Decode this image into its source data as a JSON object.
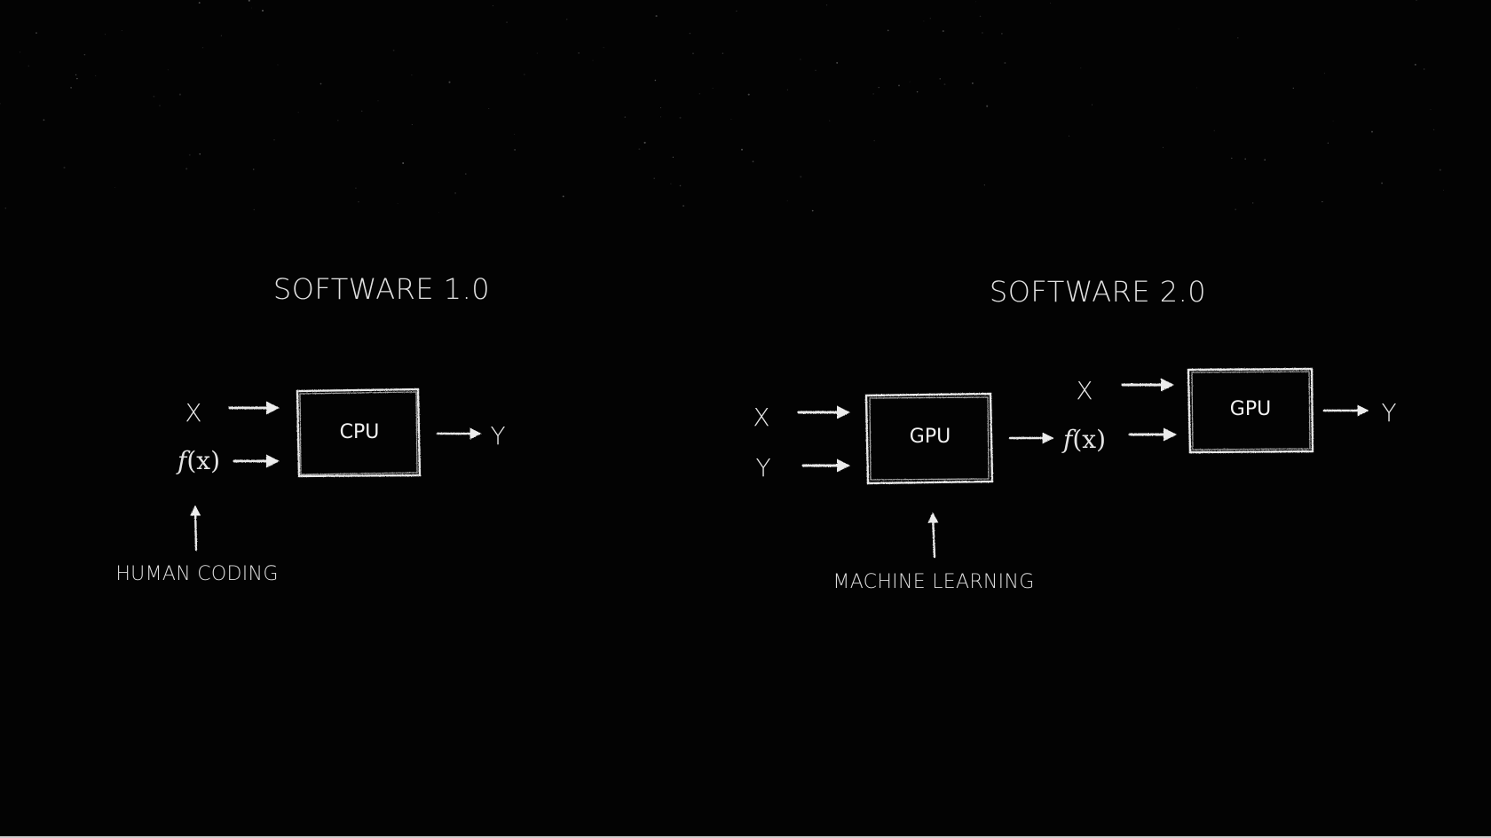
{
  "diagram": {
    "background_color": "#030303",
    "stroke_color": "#e8e8e8",
    "left_panel": {
      "title": "SOFTWARE 1.0",
      "inputs": [
        "X",
        "f(x)"
      ],
      "processor": "CPU",
      "output": "Y",
      "annotation": "HUMAN CODING",
      "annotation_target": "f(x)"
    },
    "right_panel": {
      "title": "SOFTWARE 2.0",
      "stage1": {
        "inputs": [
          "X",
          "Y"
        ],
        "processor": "GPU",
        "output": "f(x)"
      },
      "stage2": {
        "inputs": [
          "X",
          "f(x)"
        ],
        "processor": "GPU",
        "output": "Y"
      },
      "annotation": "MACHINE LEARNING",
      "annotation_target": "GPU"
    },
    "icons": {
      "arrow_right": "arrow-right-icon",
      "arrow_up": "arrow-up-icon"
    }
  }
}
